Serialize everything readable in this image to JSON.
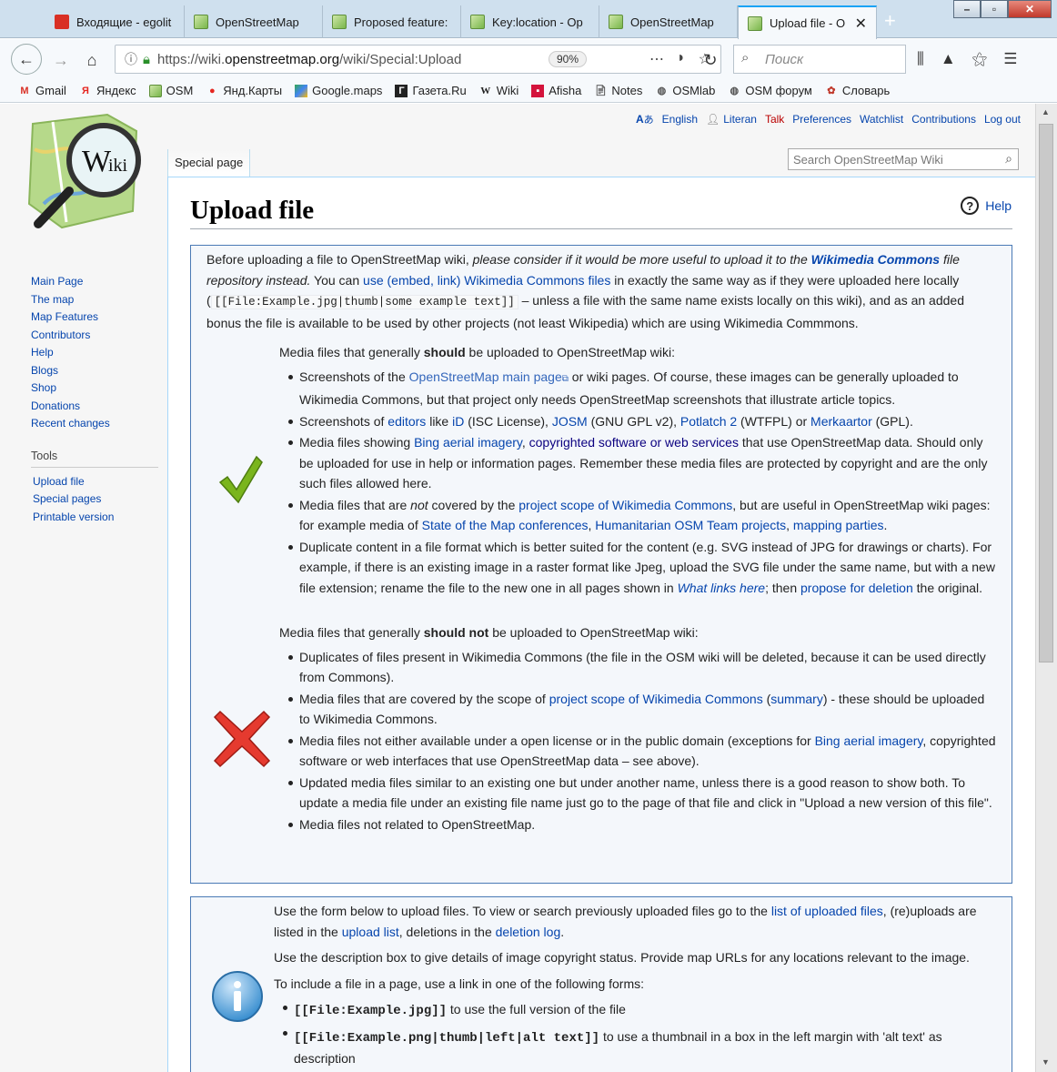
{
  "browser": {
    "tabs": [
      {
        "label": "Входящие - egolit",
        "icon": "gmail-icon"
      },
      {
        "label": "OpenStreetMap",
        "icon": "osm-icon"
      },
      {
        "label": "Proposed feature:",
        "icon": "osm-icon"
      },
      {
        "label": "Key:location - Op",
        "icon": "osm-icon"
      },
      {
        "label": "OpenStreetMap",
        "icon": "osm-icon"
      },
      {
        "label": "Upload file - O",
        "icon": "osm-icon"
      }
    ],
    "url_prefix": "https://wiki.",
    "url_domain": "openstreetmap.org",
    "url_path": "/wiki/Special:Upload",
    "zoom": "90%",
    "search_placeholder": "Поиск",
    "bookmarks": [
      "Gmail",
      "Яндекс",
      "OSM",
      "Янд.Карты",
      "Google.maps",
      "Газета.Ru",
      "Wiki",
      "Afisha",
      "Notes",
      "OSMlab",
      "OSM форум",
      "Словарь"
    ]
  },
  "wiki": {
    "personal": {
      "language": "English",
      "user": "Literan",
      "talk": "Talk",
      "preferences": "Preferences",
      "watchlist": "Watchlist",
      "contributions": "Contributions",
      "logout": "Log out"
    },
    "tab_special": "Special page",
    "search_placeholder": "Search OpenStreetMap Wiki",
    "logo_text": "Wiki",
    "nav": [
      "Main Page",
      "The map",
      "Map Features",
      "Contributors",
      "Help",
      "Blogs",
      "Shop",
      "Donations",
      "Recent changes"
    ],
    "tools_heading": "Tools",
    "tools": [
      "Upload file",
      "Special pages",
      "Printable version"
    ],
    "title": "Upload file",
    "help": "Help"
  },
  "colors": {
    "link": "#0645ad",
    "box_border": "#4a7ab5",
    "box_bg": "#f4f7fb",
    "check_green": "#7ab51d",
    "cross_red": "#e53a2f",
    "info_blue": "#3a8fd0"
  }
}
